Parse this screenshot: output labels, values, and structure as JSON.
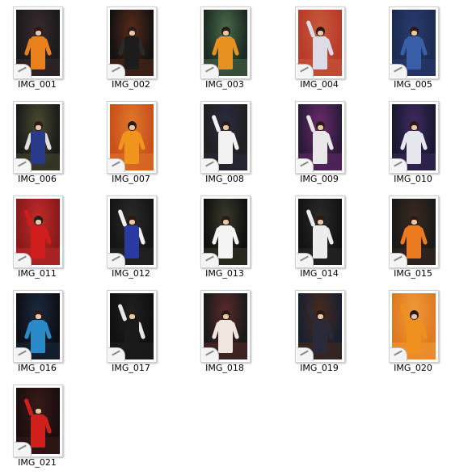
{
  "files": [
    {
      "name": "IMG_001",
      "bg": "#1a1a1a",
      "floor": "#3a2a30",
      "body": "#e8801e",
      "arms": "#e8801e",
      "pose": "down"
    },
    {
      "name": "IMG_002",
      "bg": "#121212",
      "floor": "#5a2a1a",
      "body": "#1c1c1c",
      "arms": "#2a2a2a",
      "pose": "down"
    },
    {
      "name": "IMG_003",
      "bg": "#1c2a22",
      "floor": "#4a6a4a",
      "body": "#e89020",
      "arms": "#e89020",
      "pose": "down"
    },
    {
      "name": "IMG_004",
      "bg": "#b83a2a",
      "floor": "#c85a3a",
      "body": "#dcdce8",
      "arms": "#dcdce8",
      "pose": "up"
    },
    {
      "name": "IMG_005",
      "bg": "#1a2c50",
      "floor": "#2a3a70",
      "body": "#3a5fa8",
      "arms": "#3a5fa8",
      "pose": "down"
    },
    {
      "name": "IMG_006",
      "bg": "#1a1a1a",
      "floor": "#4a4a30",
      "body": "#2a3a8a",
      "arms": "#e0e0e0",
      "pose": "down"
    },
    {
      "name": "IMG_007",
      "bg": "#c8501a",
      "floor": "#e0782a",
      "body": "#f0941e",
      "arms": "#f0941e",
      "pose": "down"
    },
    {
      "name": "IMG_008",
      "bg": "#202020",
      "floor": "#2a2a40",
      "body": "#f2f2f2",
      "arms": "#f2f2f2",
      "pose": "up"
    },
    {
      "name": "IMG_009",
      "bg": "#2a1a3a",
      "floor": "#6a2a6a",
      "body": "#e8e8e8",
      "arms": "#e8e8e8",
      "pose": "up"
    },
    {
      "name": "IMG_010",
      "bg": "#181830",
      "floor": "#402a60",
      "body": "#e6e6ee",
      "arms": "#e6e6ee",
      "pose": "down"
    },
    {
      "name": "IMG_011",
      "bg": "#8a1a1a",
      "floor": "#c02a2a",
      "body": "#d01e1e",
      "arms": "#d01e1e",
      "pose": "up"
    },
    {
      "name": "IMG_012",
      "bg": "#141414",
      "floor": "#2a2a2a",
      "body": "#2a3aa0",
      "arms": "#f0f0f0",
      "pose": "up"
    },
    {
      "name": "IMG_013",
      "bg": "#101010",
      "floor": "#3a3a2a",
      "body": "#f4f4f4",
      "arms": "#f4f4f4",
      "pose": "down"
    },
    {
      "name": "IMG_014",
      "bg": "#121212",
      "floor": "#2a2a2a",
      "body": "#ececec",
      "arms": "#ececec",
      "pose": "up"
    },
    {
      "name": "IMG_015",
      "bg": "#1a1a1a",
      "floor": "#3a2a20",
      "body": "#ec7a1e",
      "arms": "#ec7a1e",
      "pose": "down"
    },
    {
      "name": "IMG_016",
      "bg": "#0e0e14",
      "floor": "#1a2a40",
      "body": "#2a8ac8",
      "arms": "#2a8ac8",
      "pose": "down"
    },
    {
      "name": "IMG_017",
      "bg": "#101010",
      "floor": "#202020",
      "body": "#1a1a1a",
      "arms": "#e6e6e6",
      "pose": "up"
    },
    {
      "name": "IMG_018",
      "bg": "#1a1a1a",
      "floor": "#5a2a2a",
      "body": "#efe6e0",
      "arms": "#efe6e0",
      "pose": "down"
    },
    {
      "name": "IMG_019",
      "bg": "#182030",
      "floor": "#4a2a1a",
      "body": "#2a2a3a",
      "arms": "#2a2a3a",
      "pose": "up"
    },
    {
      "name": "IMG_020",
      "bg": "#e07a1e",
      "floor": "#f09a3a",
      "body": "#f0901e",
      "arms": "#f0901e",
      "pose": "up"
    },
    {
      "name": "IMG_021",
      "bg": "#1a0e0e",
      "floor": "#3a1a1a",
      "body": "#d0201e",
      "arms": "#d0201e",
      "pose": "up"
    }
  ]
}
